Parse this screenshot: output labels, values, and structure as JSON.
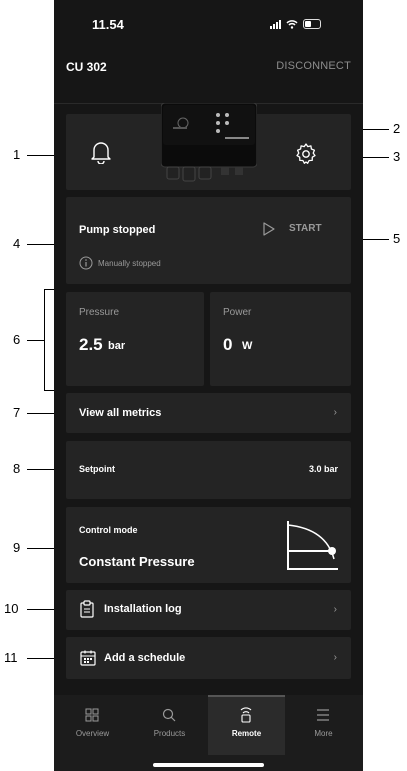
{
  "status_bar": {
    "time": "11.54"
  },
  "header": {
    "device_title": "CU 302",
    "disconnect_label": "DISCONNECT"
  },
  "pump_status": {
    "title": "Pump stopped",
    "subtitle": "Manually stopped",
    "start_label": "START"
  },
  "metrics": {
    "pressure": {
      "label": "Pressure",
      "value": "2.5",
      "unit": "bar"
    },
    "power": {
      "label": "Power",
      "value": "0",
      "unit": "W"
    }
  },
  "view_all_metrics": "View all metrics",
  "setpoint": {
    "label": "Setpoint",
    "value": "3.0 bar"
  },
  "control_mode": {
    "label": "Control mode",
    "value": "Constant Pressure"
  },
  "installation_log": "Installation log",
  "add_schedule": "Add a schedule",
  "nav": [
    {
      "label": "Overview",
      "icon": "grid-icon"
    },
    {
      "label": "Products",
      "icon": "search-icon"
    },
    {
      "label": "Remote",
      "icon": "remote-icon",
      "active": true
    },
    {
      "label": "More",
      "icon": "menu-icon"
    }
  ],
  "callouts": [
    "1",
    "2",
    "3",
    "4",
    "5",
    "6",
    "7",
    "8",
    "9",
    "10",
    "11"
  ],
  "colors": {
    "background": "#161616",
    "card": "#242424",
    "muted": "#9a9a9a"
  }
}
